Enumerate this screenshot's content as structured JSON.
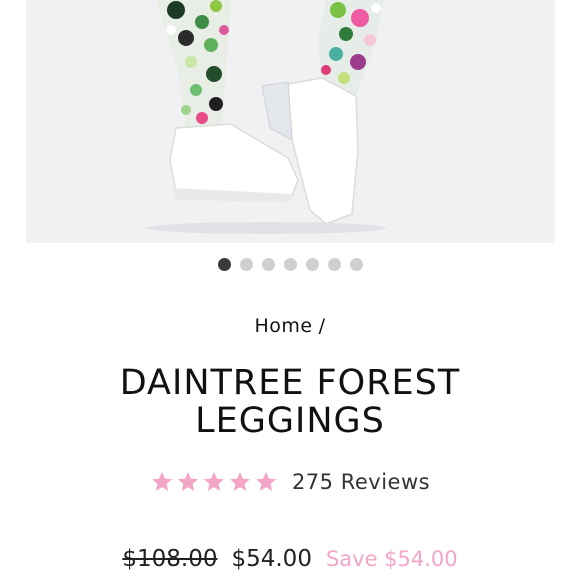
{
  "product": {
    "image_alt": "Daintree forest print leggings with white sneakers",
    "carousel": {
      "total": 7,
      "active": 1
    },
    "breadcrumb": {
      "home": "Home",
      "separator": "/"
    },
    "title_line1": "DAINTREE FOREST",
    "title_line2": "LEGGINGS",
    "rating": {
      "stars": 5,
      "star_color": "#f3a6c8"
    },
    "reviews_label": "275 Reviews",
    "price": {
      "compare_at": "$108.00",
      "current": "$54.00",
      "save_label": "Save $54.00",
      "save_color": "#f3a6c8"
    }
  }
}
